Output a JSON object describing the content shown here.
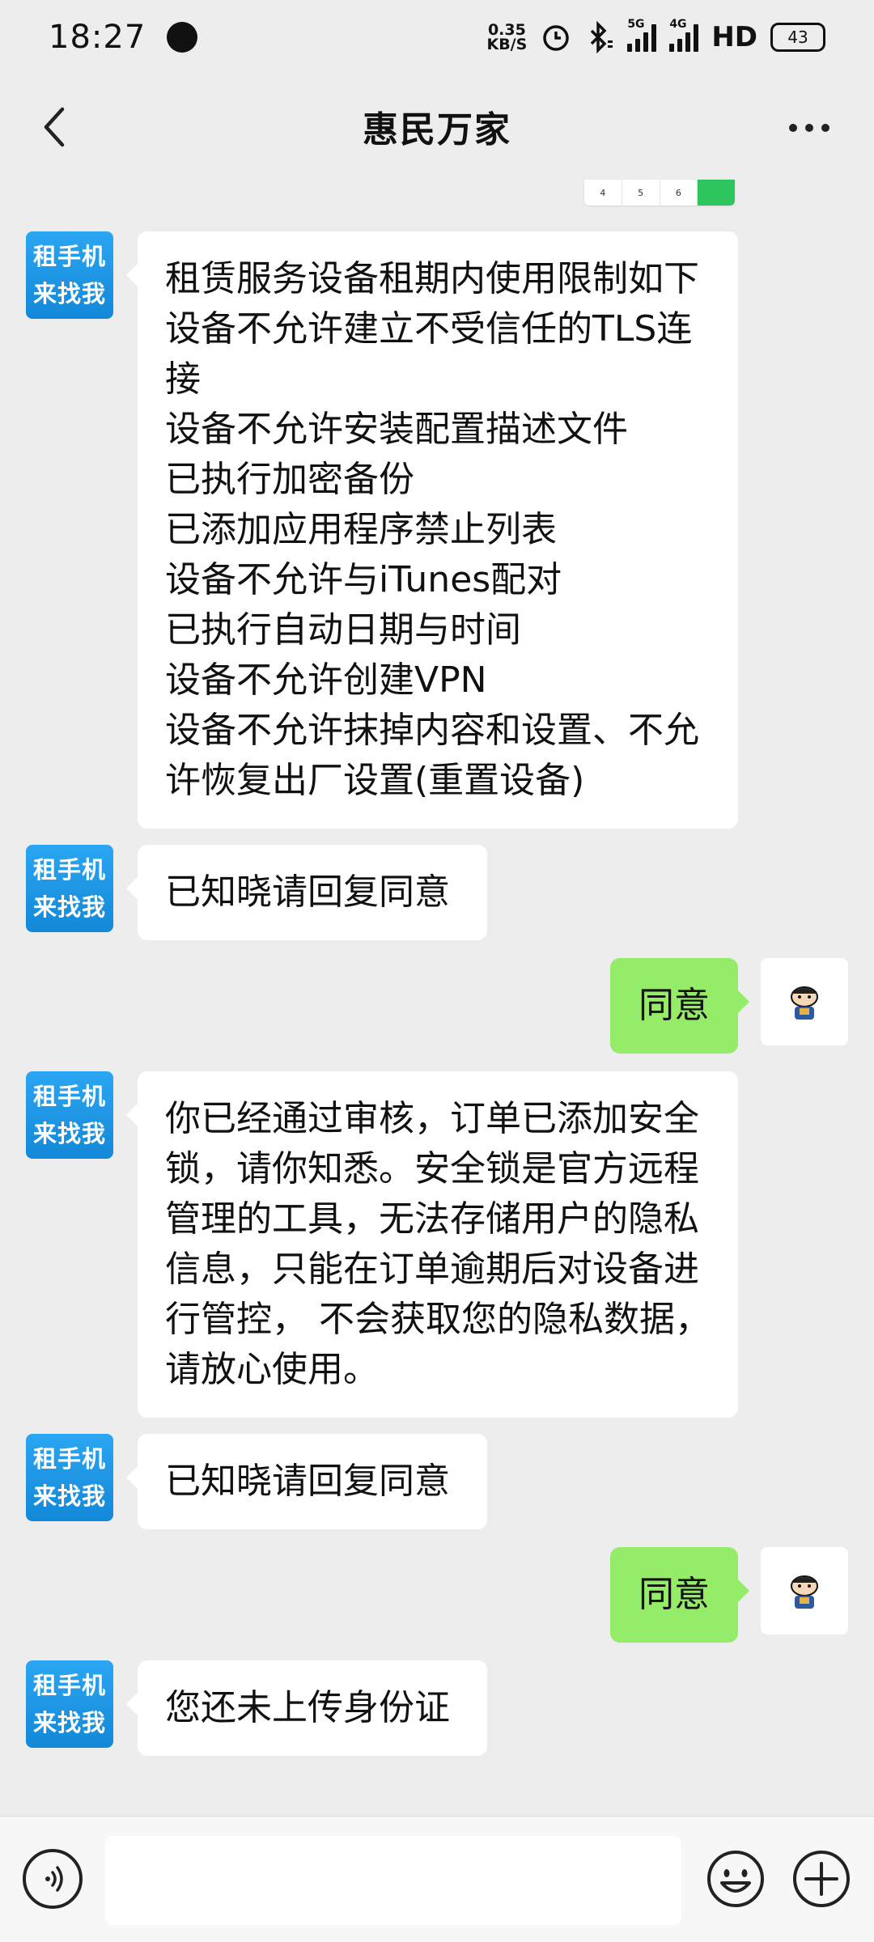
{
  "status": {
    "time": "18:27",
    "net_speed_value": "0.35",
    "net_speed_unit": "KB/S",
    "signal_1_label": "5G",
    "signal_2_label": "4G",
    "hd_label": "HD",
    "battery": "43"
  },
  "header": {
    "title": "惠民万家"
  },
  "partial_image": {
    "cells": [
      "4",
      "5",
      "6"
    ]
  },
  "bot": {
    "avatar_line1": "租手机",
    "avatar_line2": "来找我"
  },
  "messages": [
    {
      "from": "bot",
      "text": "租赁服务设备租期内使用限制如下\n设备不允许建立不受信任的TLS连接\n设备不允许安装配置描述文件\n已执行加密备份\n已添加应用程序禁止列表\n设备不允许与iTunes配对\n已执行自动日期与时间\n设备不允许创建VPN\n设备不允许抹掉内容和设置、不允许恢复出厂设置(重置设备)"
    },
    {
      "from": "bot",
      "text": "已知晓请回复同意"
    },
    {
      "from": "me",
      "text": "同意"
    },
    {
      "from": "bot",
      "text": "你已经通过审核，订单已添加安全锁，请你知悉。安全锁是官方远程管理的工具，无法存储用户的隐私信息，只能在订单逾期后对设备进行管控， 不会获取您的隐私数据，请放心使用。"
    },
    {
      "from": "bot",
      "text": "已知晓请回复同意"
    },
    {
      "from": "me",
      "text": "同意"
    },
    {
      "from": "bot",
      "text": "您还未上传身份证"
    }
  ],
  "colors": {
    "background": "#ededed",
    "my_bubble": "#95ec69",
    "bot_avatar": "#1a97e6"
  }
}
